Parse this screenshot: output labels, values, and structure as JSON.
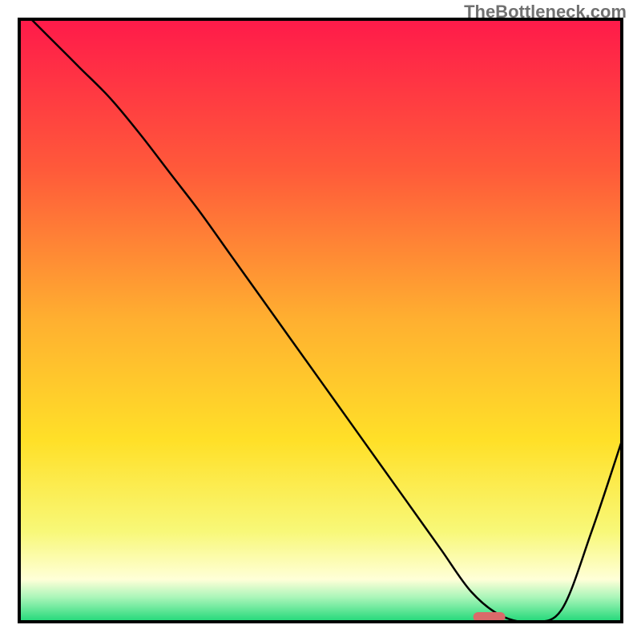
{
  "watermark": "TheBottleneck.com",
  "chart_data": {
    "type": "line",
    "title": "",
    "xlabel": "",
    "ylabel": "",
    "xlim": [
      0,
      100
    ],
    "ylim": [
      0,
      100
    ],
    "x": [
      2,
      5,
      10,
      15,
      20,
      25,
      30,
      35,
      40,
      45,
      50,
      55,
      60,
      65,
      70,
      75,
      80,
      85,
      90,
      95,
      100
    ],
    "y": [
      100,
      97,
      92,
      87,
      81,
      74.5,
      68,
      61,
      54,
      47,
      40,
      33,
      26,
      19,
      12,
      5,
      1,
      0,
      2,
      15,
      30
    ],
    "marker": {
      "x": 78,
      "color": "#d96a6a"
    },
    "gradient_stops": [
      {
        "offset": 0,
        "color": "#ff1a4a"
      },
      {
        "offset": 0.25,
        "color": "#ff5a3a"
      },
      {
        "offset": 0.5,
        "color": "#ffb030"
      },
      {
        "offset": 0.7,
        "color": "#ffe028"
      },
      {
        "offset": 0.85,
        "color": "#f8f878"
      },
      {
        "offset": 0.93,
        "color": "#ffffd8"
      },
      {
        "offset": 0.96,
        "color": "#a8f5b8"
      },
      {
        "offset": 1.0,
        "color": "#20d878"
      }
    ]
  }
}
